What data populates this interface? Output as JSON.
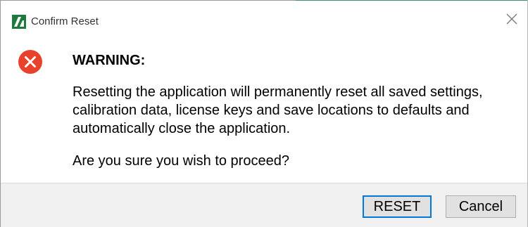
{
  "window": {
    "title": "Confirm Reset",
    "close_icon": "close-icon",
    "app_icon": "app-logo-icon"
  },
  "content": {
    "icon": "error-icon",
    "heading": "WARNING:",
    "message": "Resetting the application will permanently reset all saved settings, calibration data, license keys and save locations to defaults and automatically close the application.",
    "question": "Are you sure you wish to proceed?"
  },
  "buttons": {
    "reset_label": "RESET",
    "cancel_label": "Cancel"
  },
  "colors": {
    "error_red": "#e8412c",
    "app_green": "#1c7a3f",
    "focus_blue": "#0078d7"
  }
}
